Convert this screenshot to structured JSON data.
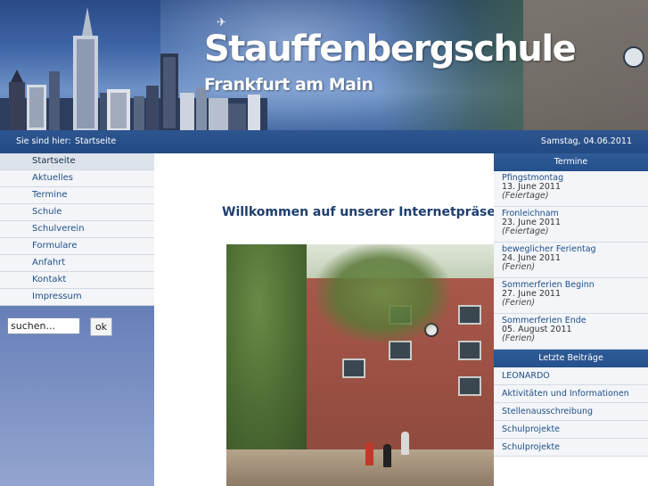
{
  "header": {
    "title": "Stauffenbergschule",
    "subtitle": "Frankfurt am Main"
  },
  "breadcrumb": {
    "label": "Sie sind hier:",
    "current": "Startseite",
    "date": "Samstag, 04.06.2011"
  },
  "nav": {
    "items": [
      {
        "label": "Startseite",
        "active": true
      },
      {
        "label": "Aktuelles"
      },
      {
        "label": "Termine"
      },
      {
        "label": "Schule"
      },
      {
        "label": "Schulverein"
      },
      {
        "label": "Formulare"
      },
      {
        "label": "Anfahrt"
      },
      {
        "label": "Kontakt"
      },
      {
        "label": "Impressum"
      }
    ]
  },
  "search": {
    "value": "suchen...",
    "button": "ok"
  },
  "main": {
    "welcome": "Willkommen auf unserer Internetpräsenz"
  },
  "termine": {
    "heading": "Termine",
    "items": [
      {
        "title": "Pfingstmontag",
        "date": "13. June 2011",
        "category": "(Feiertage)"
      },
      {
        "title": "Fronleichnam",
        "date": "23. June 2011",
        "category": "(Feiertage)"
      },
      {
        "title": "beweglicher Ferientag",
        "date": "24. June 2011",
        "category": "(Ferien)"
      },
      {
        "title": "Sommerferien Beginn",
        "date": "27. June 2011",
        "category": "(Ferien)"
      },
      {
        "title": "Sommerferien Ende",
        "date": "05. August 2011",
        "category": "(Ferien)"
      }
    ]
  },
  "beitraege": {
    "heading": "Letzte Beiträge",
    "items": [
      {
        "label": "LEONARDO"
      },
      {
        "label": "Aktivitäten und Informationen"
      },
      {
        "label": "Stellenausschreibung"
      },
      {
        "label": "Schulprojekte"
      },
      {
        "label": "Schulprojekte"
      }
    ]
  },
  "colors": {
    "accent": "#24508b",
    "link": "#1f4f8a",
    "nav_background": "#f3f5f8"
  }
}
